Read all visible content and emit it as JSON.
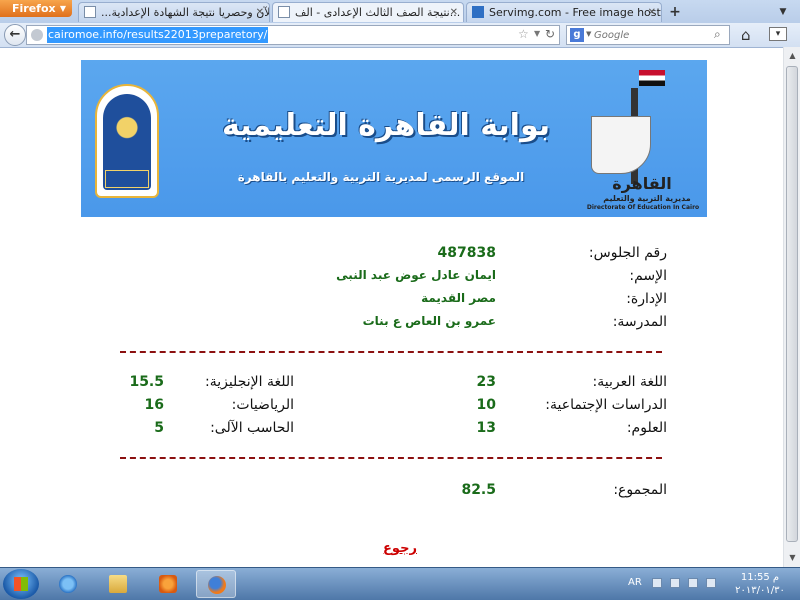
{
  "browser": {
    "menu_label": "Firefox",
    "tabs": [
      {
        "label": "...الآن وحصريا نتيجة الشهادة الإعدادية"
      },
      {
        "label": "نتيجة الصف الثالث الإعدادى - الف..."
      },
      {
        "label": "Servimg.com - Free image hosting se..."
      }
    ],
    "new_tab_label": "+",
    "url": "cairomoe.info/results22013preparetory/",
    "search_placeholder": "Google",
    "search_engine_letter": "g"
  },
  "banner": {
    "title": "بوابة القاهرة التعليمية",
    "subtitle": "الموقع الرسمى لمديرية التربية والتعليم بالقاهرة",
    "logo_wordmark": "القاهرة",
    "logo_sub_ar": "مديرية التربية والتعليم",
    "logo_sub_en": "Directorate Of Education In Cairo"
  },
  "student": {
    "seat_label": "رقم الجلوس:",
    "seat_value": "487838",
    "name_label": "الإسم:",
    "name_value": "ايمان عادل عوض عبد النبى",
    "admin_label": "الإدارة:",
    "admin_value": "مصر القديمة",
    "school_label": "المدرسة:",
    "school_value": "عمرو بن العاص ع بنات"
  },
  "grades": {
    "arabic_label": "اللغة العربية:",
    "arabic_value": "23",
    "english_label": "اللغة الإنجليزية:",
    "english_value": "15.5",
    "social_label": "الدراسات الإجتماعية:",
    "social_value": "10",
    "math_label": "الرياضيات:",
    "math_value": "16",
    "science_label": "العلوم:",
    "science_value": "13",
    "computer_label": "الحاسب الآلى:",
    "computer_value": "5"
  },
  "total": {
    "label": "المجموع:",
    "value": "82.5"
  },
  "back_link": "رجوع",
  "taskbar": {
    "language": "AR",
    "time": "11:55 م",
    "date": "٢٠١٣/٠١/٣٠"
  },
  "colors": {
    "value_green": "#1a6b1a",
    "separator_red": "#8b1010",
    "banner_blue": "#4a98ea",
    "link_red": "#cc0000"
  }
}
